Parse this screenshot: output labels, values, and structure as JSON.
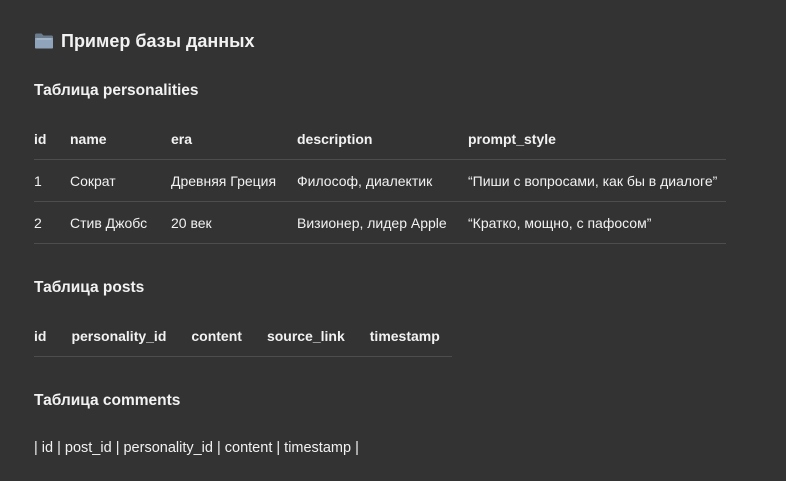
{
  "document": {
    "title": "Пример базы данных",
    "title_icon": "folder-icon"
  },
  "personalities": {
    "heading": "Таблица personalities",
    "columns": [
      "id",
      "name",
      "era",
      "description",
      "prompt_style"
    ],
    "rows": [
      [
        "1",
        "Сократ",
        "Древняя Греция",
        "Философ, диалектик",
        "“Пиши с вопросами, как бы в диалоге”"
      ],
      [
        "2",
        "Стив Джобс",
        "20 век",
        "Визионер, лидер Apple",
        "“Кратко, мощно, с пафосом”"
      ]
    ]
  },
  "posts": {
    "heading": "Таблица posts",
    "columns": [
      "id",
      "personality_id",
      "content",
      "source_link",
      "timestamp"
    ]
  },
  "comments": {
    "heading": "Таблица comments",
    "raw_line": "| id | post_id | personality_id | content  | timestamp |"
  },
  "colors": {
    "background": "#333333",
    "text": "#f2f2f2",
    "divider": "#4d4d4d"
  }
}
